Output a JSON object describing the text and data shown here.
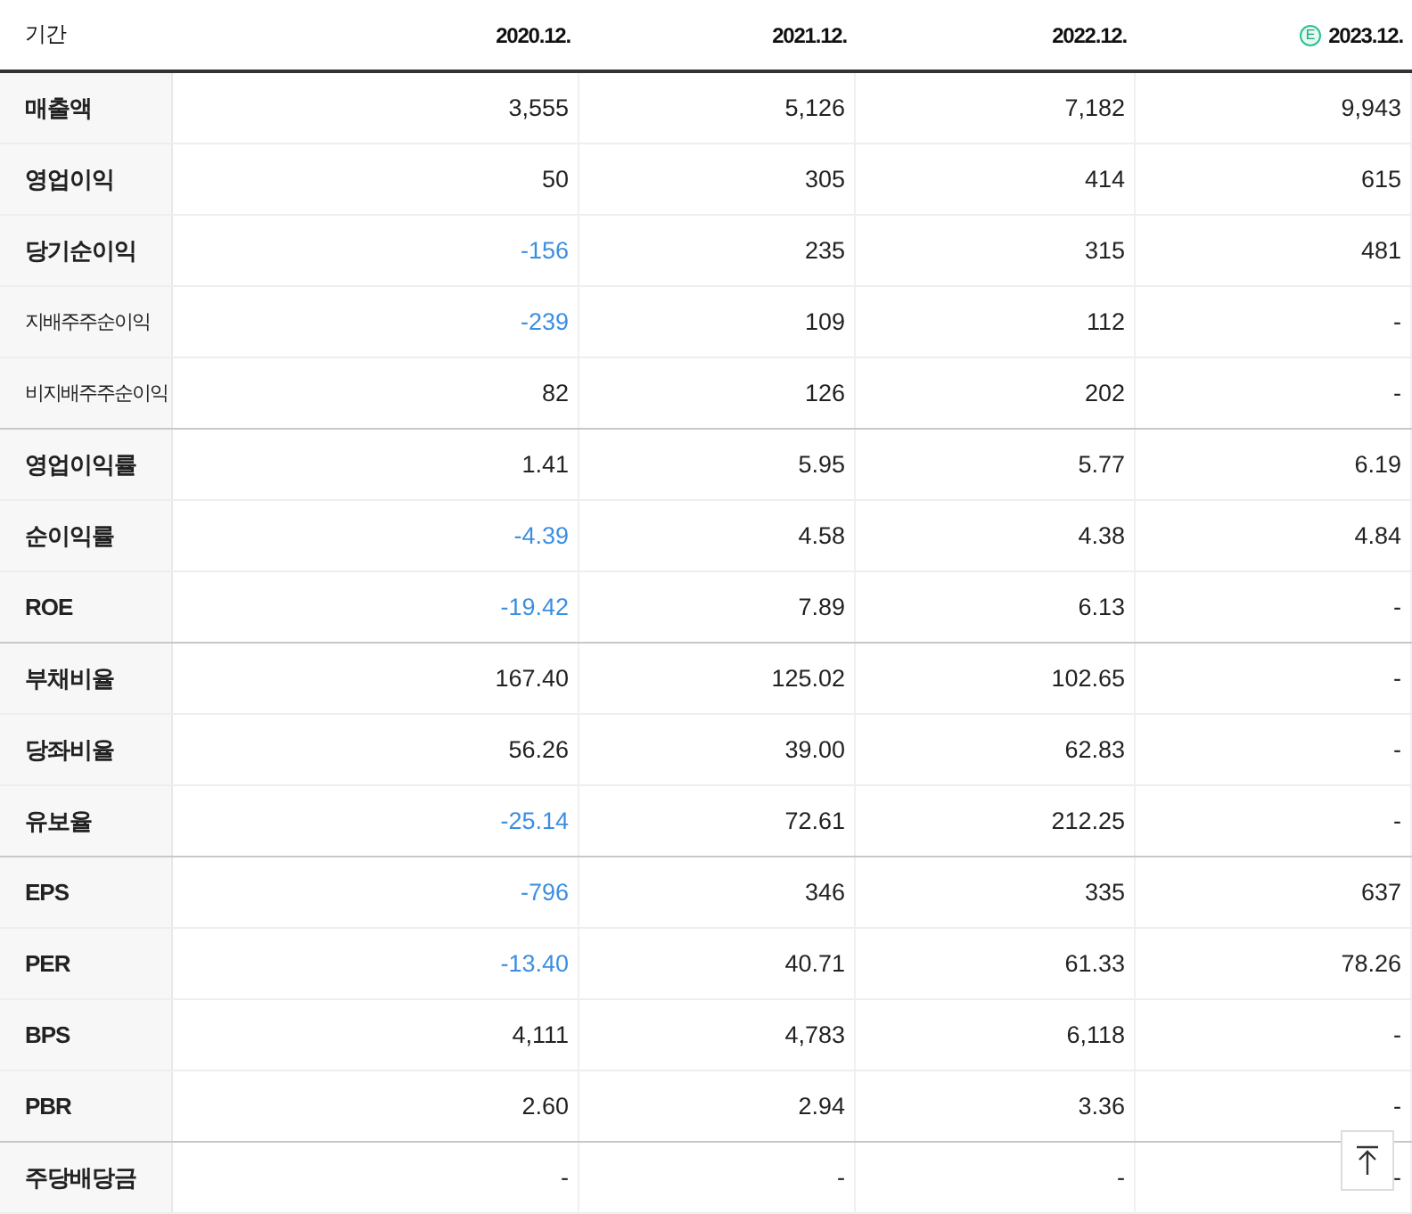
{
  "table": {
    "corner_label": "기간",
    "columns": [
      {
        "label": "2020.12."
      },
      {
        "label": "2021.12."
      },
      {
        "label": "2022.12."
      },
      {
        "label": "2023.12.",
        "badge": "E"
      }
    ],
    "rows": [
      {
        "label": "매출액",
        "kind": "main",
        "group_end": false,
        "cells": [
          {
            "text": "3,555",
            "negative": false
          },
          {
            "text": "5,126",
            "negative": false
          },
          {
            "text": "7,182",
            "negative": false
          },
          {
            "text": "9,943",
            "negative": false
          }
        ]
      },
      {
        "label": "영업이익",
        "kind": "main",
        "group_end": false,
        "cells": [
          {
            "text": "50",
            "negative": false
          },
          {
            "text": "305",
            "negative": false
          },
          {
            "text": "414",
            "negative": false
          },
          {
            "text": "615",
            "negative": false
          }
        ]
      },
      {
        "label": "당기순이익",
        "kind": "main",
        "group_end": false,
        "cells": [
          {
            "text": "-156",
            "negative": true
          },
          {
            "text": "235",
            "negative": false
          },
          {
            "text": "315",
            "negative": false
          },
          {
            "text": "481",
            "negative": false
          }
        ]
      },
      {
        "label": "지배주주순이익",
        "kind": "sub",
        "group_end": false,
        "cells": [
          {
            "text": "-239",
            "negative": true
          },
          {
            "text": "109",
            "negative": false
          },
          {
            "text": "112",
            "negative": false
          },
          {
            "text": "-",
            "negative": false
          }
        ]
      },
      {
        "label": "비지배주주순이익",
        "kind": "sub",
        "group_end": true,
        "cells": [
          {
            "text": "82",
            "negative": false
          },
          {
            "text": "126",
            "negative": false
          },
          {
            "text": "202",
            "negative": false
          },
          {
            "text": "-",
            "negative": false
          }
        ]
      },
      {
        "label": "영업이익률",
        "kind": "main",
        "group_end": false,
        "cells": [
          {
            "text": "1.41",
            "negative": false
          },
          {
            "text": "5.95",
            "negative": false
          },
          {
            "text": "5.77",
            "negative": false
          },
          {
            "text": "6.19",
            "negative": false
          }
        ]
      },
      {
        "label": "순이익률",
        "kind": "main",
        "group_end": false,
        "cells": [
          {
            "text": "-4.39",
            "negative": true
          },
          {
            "text": "4.58",
            "negative": false
          },
          {
            "text": "4.38",
            "negative": false
          },
          {
            "text": "4.84",
            "negative": false
          }
        ]
      },
      {
        "label": "ROE",
        "kind": "main",
        "group_end": true,
        "cells": [
          {
            "text": "-19.42",
            "negative": true
          },
          {
            "text": "7.89",
            "negative": false
          },
          {
            "text": "6.13",
            "negative": false
          },
          {
            "text": "-",
            "negative": false
          }
        ]
      },
      {
        "label": "부채비율",
        "kind": "main",
        "group_end": false,
        "cells": [
          {
            "text": "167.40",
            "negative": false
          },
          {
            "text": "125.02",
            "negative": false
          },
          {
            "text": "102.65",
            "negative": false
          },
          {
            "text": "-",
            "negative": false
          }
        ]
      },
      {
        "label": "당좌비율",
        "kind": "main",
        "group_end": false,
        "cells": [
          {
            "text": "56.26",
            "negative": false
          },
          {
            "text": "39.00",
            "negative": false
          },
          {
            "text": "62.83",
            "negative": false
          },
          {
            "text": "-",
            "negative": false
          }
        ]
      },
      {
        "label": "유보율",
        "kind": "main",
        "group_end": true,
        "cells": [
          {
            "text": "-25.14",
            "negative": true
          },
          {
            "text": "72.61",
            "negative": false
          },
          {
            "text": "212.25",
            "negative": false
          },
          {
            "text": "-",
            "negative": false
          }
        ]
      },
      {
        "label": "EPS",
        "kind": "main",
        "group_end": false,
        "cells": [
          {
            "text": "-796",
            "negative": true
          },
          {
            "text": "346",
            "negative": false
          },
          {
            "text": "335",
            "negative": false
          },
          {
            "text": "637",
            "negative": false
          }
        ]
      },
      {
        "label": "PER",
        "kind": "main",
        "group_end": false,
        "cells": [
          {
            "text": "-13.40",
            "negative": true
          },
          {
            "text": "40.71",
            "negative": false
          },
          {
            "text": "61.33",
            "negative": false
          },
          {
            "text": "78.26",
            "negative": false
          }
        ]
      },
      {
        "label": "BPS",
        "kind": "main",
        "group_end": false,
        "cells": [
          {
            "text": "4,111",
            "negative": false
          },
          {
            "text": "4,783",
            "negative": false
          },
          {
            "text": "6,118",
            "negative": false
          },
          {
            "text": "-",
            "negative": false
          }
        ]
      },
      {
        "label": "PBR",
        "kind": "main",
        "group_end": true,
        "cells": [
          {
            "text": "2.60",
            "negative": false
          },
          {
            "text": "2.94",
            "negative": false
          },
          {
            "text": "3.36",
            "negative": false
          },
          {
            "text": "-",
            "negative": false
          }
        ]
      },
      {
        "label": "주당배당금",
        "kind": "main",
        "group_end": false,
        "cells": [
          {
            "text": "-",
            "negative": false
          },
          {
            "text": "-",
            "negative": false
          },
          {
            "text": "-",
            "negative": false
          },
          {
            "text": "-",
            "negative": false
          }
        ]
      }
    ]
  }
}
